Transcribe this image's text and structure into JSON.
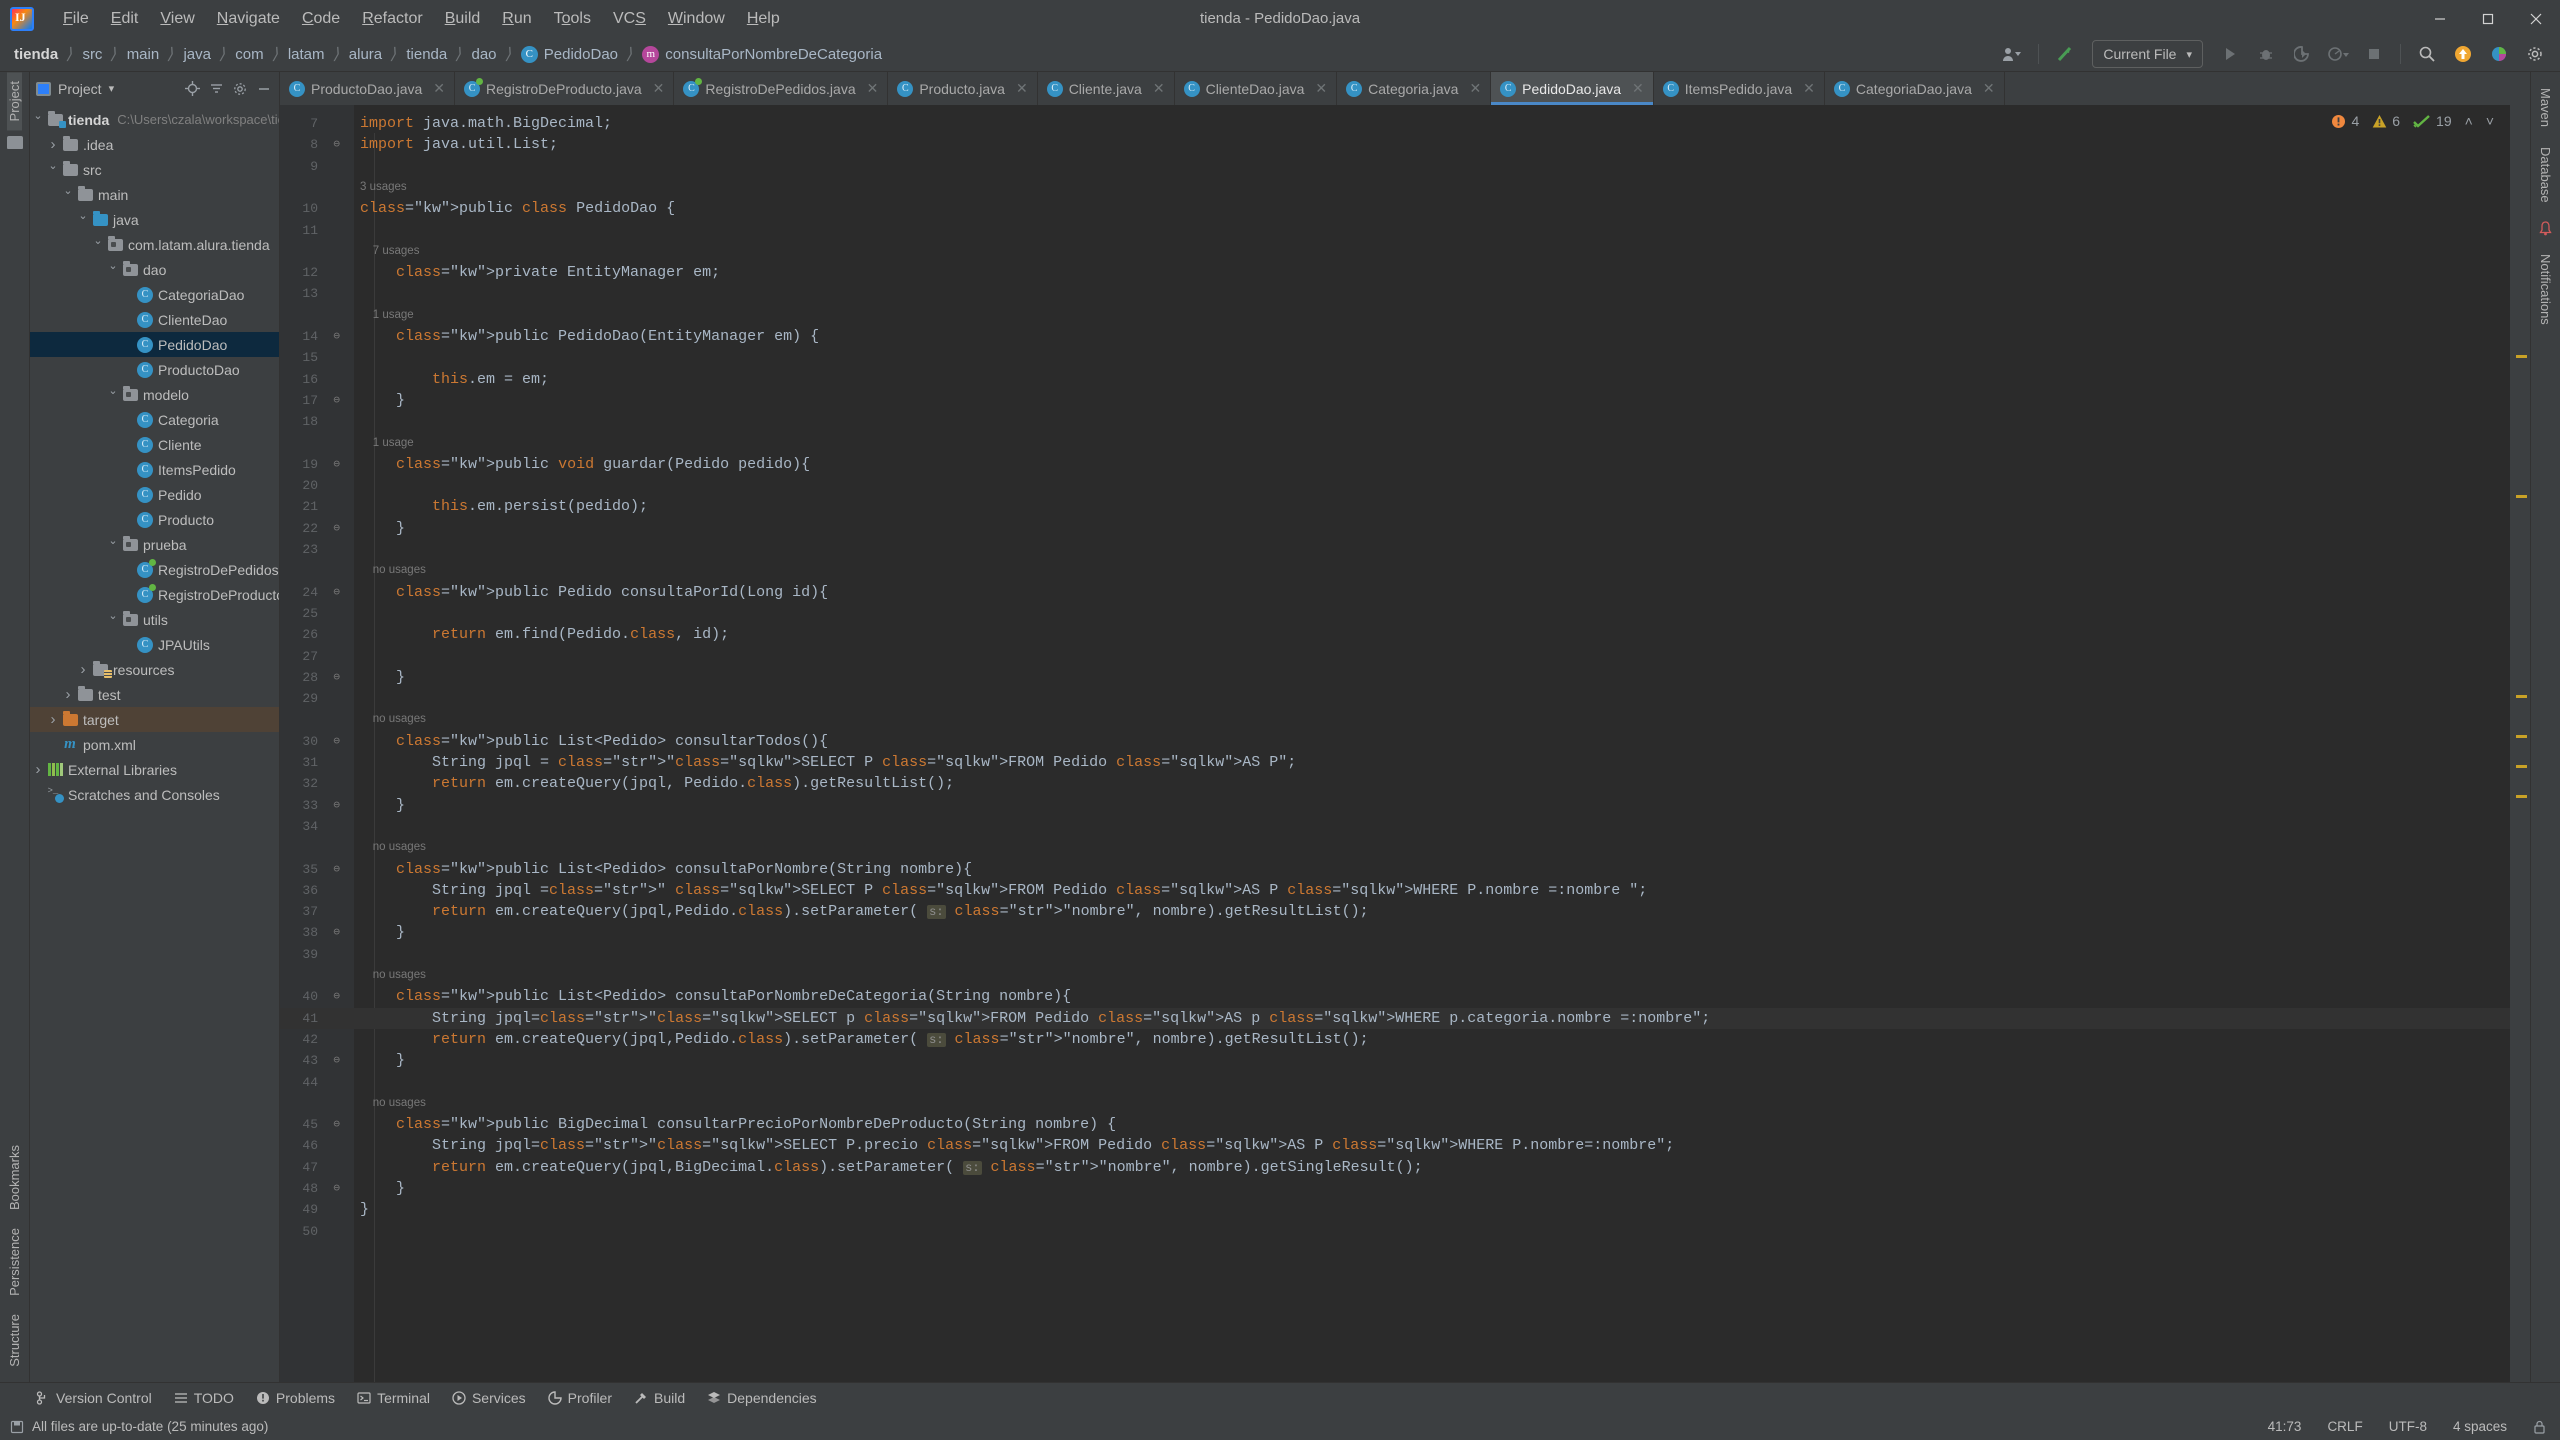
{
  "window": {
    "app_icon": "intellij-idea-logo",
    "title": "tienda - PedidoDao.java",
    "minimize": "–",
    "maximize": "☐",
    "close": "✕"
  },
  "menu": {
    "items": [
      "File",
      "Edit",
      "View",
      "Navigate",
      "Code",
      "Refactor",
      "Build",
      "Run",
      "Tools",
      "VCS",
      "Window",
      "Help"
    ]
  },
  "navbar": {
    "breadcrumbs": [
      {
        "label": "tienda",
        "icon": "",
        "bold": true
      },
      {
        "label": "src",
        "icon": ""
      },
      {
        "label": "main",
        "icon": ""
      },
      {
        "label": "java",
        "icon": ""
      },
      {
        "label": "com",
        "icon": ""
      },
      {
        "label": "latam",
        "icon": ""
      },
      {
        "label": "alura",
        "icon": ""
      },
      {
        "label": "tienda",
        "icon": ""
      },
      {
        "label": "dao",
        "icon": ""
      },
      {
        "label": "PedidoDao",
        "icon": "class-icon",
        "icon_letter": "C"
      },
      {
        "label": "consultaPorNombreDeCategoria",
        "icon": "method-icon",
        "icon_letter": "m"
      }
    ],
    "run_config": "Current File",
    "run_config_caret": "▾",
    "icons": [
      "user-avatar-icon",
      "vcs-update-icon",
      "run-icon",
      "debug-icon",
      "run-coverage-icon",
      "profiler-icon",
      "stop-icon",
      "search-everywhere-icon",
      "updates-available-icon",
      "ide-features-icon",
      "settings-icon"
    ]
  },
  "left_strip": {
    "project_tab": "Project",
    "bottom_tabs": [
      "Bookmarks",
      "Persistence",
      "Structure"
    ]
  },
  "right_strip": {
    "tabs": [
      "Maven",
      "Database",
      "Notifications"
    ]
  },
  "project_panel": {
    "title": "Project",
    "title_caret": "▾",
    "header_icons": [
      "locate-icon",
      "collapse-all-icon",
      "settings-icon",
      "hide-icon"
    ],
    "tree": [
      {
        "depth": 0,
        "chev": "open",
        "icon": "module-folder-icon",
        "label": "tienda",
        "bold": true,
        "path": "C:\\Users\\czala\\workspace\\tienda"
      },
      {
        "depth": 1,
        "chev": "closed",
        "icon": "folder-icon",
        "label": ".idea"
      },
      {
        "depth": 1,
        "chev": "open",
        "icon": "folder-icon",
        "label": "src"
      },
      {
        "depth": 2,
        "chev": "open",
        "icon": "folder-icon",
        "label": "main"
      },
      {
        "depth": 3,
        "chev": "open",
        "icon": "source-folder-icon",
        "label": "java"
      },
      {
        "depth": 4,
        "chev": "open",
        "icon": "package-icon",
        "label": "com.latam.alura.tienda"
      },
      {
        "depth": 5,
        "chev": "open",
        "icon": "package-icon",
        "label": "dao"
      },
      {
        "depth": 6,
        "chev": "blank",
        "icon": "class-icon",
        "label": "CategoriaDao"
      },
      {
        "depth": 6,
        "chev": "blank",
        "icon": "class-icon",
        "label": "ClienteDao"
      },
      {
        "depth": 6,
        "chev": "blank",
        "icon": "class-icon",
        "label": "PedidoDao",
        "selected": true
      },
      {
        "depth": 6,
        "chev": "blank",
        "icon": "class-icon",
        "label": "ProductoDao"
      },
      {
        "depth": 5,
        "chev": "open",
        "icon": "package-icon",
        "label": "modelo"
      },
      {
        "depth": 6,
        "chev": "blank",
        "icon": "class-icon",
        "label": "Categoria"
      },
      {
        "depth": 6,
        "chev": "blank",
        "icon": "class-icon",
        "label": "Cliente"
      },
      {
        "depth": 6,
        "chev": "blank",
        "icon": "class-icon",
        "label": "ItemsPedido"
      },
      {
        "depth": 6,
        "chev": "blank",
        "icon": "class-icon",
        "label": "Pedido"
      },
      {
        "depth": 6,
        "chev": "blank",
        "icon": "class-icon",
        "label": "Producto"
      },
      {
        "depth": 5,
        "chev": "open",
        "icon": "package-icon",
        "label": "prueba"
      },
      {
        "depth": 6,
        "chev": "blank",
        "icon": "runnable-class-icon",
        "label": "RegistroDePedidos"
      },
      {
        "depth": 6,
        "chev": "blank",
        "icon": "runnable-class-icon",
        "label": "RegistroDeProducto"
      },
      {
        "depth": 5,
        "chev": "open",
        "icon": "package-icon",
        "label": "utils"
      },
      {
        "depth": 6,
        "chev": "blank",
        "icon": "class-icon",
        "label": "JPAUtils"
      },
      {
        "depth": 3,
        "chev": "closed",
        "icon": "resources-folder-icon",
        "label": "resources"
      },
      {
        "depth": 2,
        "chev": "closed",
        "icon": "folder-icon",
        "label": "test"
      },
      {
        "depth": 1,
        "chev": "closed",
        "icon": "excluded-folder-icon",
        "label": "target",
        "highlighted": true
      },
      {
        "depth": 1,
        "chev": "blank",
        "icon": "maven-icon",
        "label": "pom.xml"
      },
      {
        "depth": 0,
        "chev": "closed",
        "icon": "library-icon",
        "label": "External Libraries"
      },
      {
        "depth": 0,
        "chev": "blank",
        "icon": "scratches-icon",
        "label": "Scratches and Consoles"
      }
    ]
  },
  "editor_tabs": [
    {
      "label": "ProductoDao.java",
      "icon": "class-icon"
    },
    {
      "label": "RegistroDeProducto.java",
      "icon": "runnable-class-icon"
    },
    {
      "label": "RegistroDePedidos.java",
      "icon": "runnable-class-icon"
    },
    {
      "label": "Producto.java",
      "icon": "class-icon"
    },
    {
      "label": "Cliente.java",
      "icon": "class-icon"
    },
    {
      "label": "ClienteDao.java",
      "icon": "class-icon"
    },
    {
      "label": "Categoria.java",
      "icon": "class-icon"
    },
    {
      "label": "PedidoDao.java",
      "icon": "class-icon",
      "active": true
    },
    {
      "label": "ItemsPedido.java",
      "icon": "class-icon"
    },
    {
      "label": "CategoriaDao.java",
      "icon": "class-icon"
    }
  ],
  "inspections": {
    "error_count": "4",
    "warning_count": "6",
    "ok_count": "19",
    "prev_label": "˄",
    "next_label": "˅"
  },
  "editor": {
    "first_line_number": 7,
    "lines": [
      {
        "n": 7,
        "text": "import java.math.BigDecimal;"
      },
      {
        "n": 8,
        "text": "import java.util.List;",
        "fold": "minus-square"
      },
      {
        "n": 9,
        "text": ""
      },
      {
        "n": null,
        "hint": "3 usages"
      },
      {
        "n": 10,
        "text": "public class PedidoDao {"
      },
      {
        "n": 11,
        "text": ""
      },
      {
        "n": null,
        "hint": "    7 usages"
      },
      {
        "n": 12,
        "text": "    private EntityManager em;"
      },
      {
        "n": 13,
        "text": ""
      },
      {
        "n": null,
        "hint": "    1 usage"
      },
      {
        "n": 14,
        "text": "    public PedidoDao(EntityManager em) {",
        "fold": "fold-start"
      },
      {
        "n": 15,
        "text": ""
      },
      {
        "n": 16,
        "text": "        this.em = em;"
      },
      {
        "n": 17,
        "text": "    }",
        "fold": "fold-end"
      },
      {
        "n": 18,
        "text": ""
      },
      {
        "n": null,
        "hint": "    1 usage"
      },
      {
        "n": 19,
        "text": "    public void guardar(Pedido pedido){",
        "fold": "fold-start"
      },
      {
        "n": 20,
        "text": ""
      },
      {
        "n": 21,
        "text": "        this.em.persist(pedido);"
      },
      {
        "n": 22,
        "text": "    }",
        "fold": "fold-end"
      },
      {
        "n": 23,
        "text": ""
      },
      {
        "n": null,
        "hint": "    no usages"
      },
      {
        "n": 24,
        "text": "    public Pedido consultaPorId(Long id){",
        "fold": "fold-start"
      },
      {
        "n": 25,
        "text": ""
      },
      {
        "n": 26,
        "text": "        return em.find(Pedido.class, id);"
      },
      {
        "n": 27,
        "text": ""
      },
      {
        "n": 28,
        "text": "    }",
        "fold": "fold-end"
      },
      {
        "n": 29,
        "text": ""
      },
      {
        "n": null,
        "hint": "    no usages"
      },
      {
        "n": 30,
        "text": "    public List<Pedido> consultarTodos(){",
        "fold": "fold-start"
      },
      {
        "n": 31,
        "text": "        String jpql = \"SELECT P FROM Pedido AS P\";"
      },
      {
        "n": 32,
        "text": "        return em.createQuery(jpql, Pedido.class).getResultList();"
      },
      {
        "n": 33,
        "text": "    }",
        "fold": "fold-end"
      },
      {
        "n": 34,
        "text": ""
      },
      {
        "n": null,
        "hint": "    no usages"
      },
      {
        "n": 35,
        "text": "    public List<Pedido> consultaPorNombre(String nombre){",
        "fold": "fold-start"
      },
      {
        "n": 36,
        "text": "        String jpql =\" SELECT P FROM Pedido AS P WHERE P.nombre =:nombre \";"
      },
      {
        "n": 37,
        "text": "        return em.createQuery(jpql,Pedido.class).setParameter( s: \"nombre\", nombre).getResultList();"
      },
      {
        "n": 38,
        "text": "    }",
        "fold": "fold-end"
      },
      {
        "n": 39,
        "text": ""
      },
      {
        "n": null,
        "hint": "    no usages"
      },
      {
        "n": 40,
        "text": "    public List<Pedido> consultaPorNombreDeCategoria(String nombre){",
        "fold": "fold-start"
      },
      {
        "n": 41,
        "text": "        String jpql=\"SELECT p FROM Pedido AS p WHERE p.categoria.nombre =:nombre\";",
        "current": true
      },
      {
        "n": 42,
        "text": "        return em.createQuery(jpql,Pedido.class).setParameter( s: \"nombre\", nombre).getResultList();"
      },
      {
        "n": 43,
        "text": "    }",
        "fold": "fold-end"
      },
      {
        "n": 44,
        "text": ""
      },
      {
        "n": null,
        "hint": "    no usages"
      },
      {
        "n": 45,
        "text": "    public BigDecimal consultarPrecioPorNombreDeProducto(String nombre) {",
        "fold": "fold-start"
      },
      {
        "n": 46,
        "text": "        String jpql=\"SELECT P.precio FROM Pedido AS P WHERE P.nombre=:nombre\";"
      },
      {
        "n": 47,
        "text": "        return em.createQuery(jpql,BigDecimal.class).setParameter( s: \"nombre\", nombre).getSingleResult();"
      },
      {
        "n": 48,
        "text": "    }",
        "fold": "fold-end"
      },
      {
        "n": 49,
        "text": "}"
      },
      {
        "n": 50,
        "text": ""
      }
    ]
  },
  "bottom_bar": {
    "buttons": [
      {
        "label": "Version Control",
        "icon": "branch-icon"
      },
      {
        "label": "TODO",
        "icon": "list-icon"
      },
      {
        "label": "Problems",
        "icon": "error-icon"
      },
      {
        "label": "Terminal",
        "icon": "terminal-icon"
      },
      {
        "label": "Services",
        "icon": "services-icon"
      },
      {
        "label": "Profiler",
        "icon": "profiler-icon"
      },
      {
        "label": "Build",
        "icon": "hammer-icon"
      },
      {
        "label": "Dependencies",
        "icon": "dependencies-icon"
      }
    ]
  },
  "status_bar": {
    "message": "All files are up-to-date (25 minutes ago)",
    "message_icon": "save-indicator-icon",
    "caret_position": "41:73",
    "line_separator": "CRLF",
    "encoding": "UTF-8",
    "indent": "4 spaces",
    "lock_icon": "lock-icon"
  },
  "colors": {
    "bg_chrome": "#3c3f41",
    "bg_editor": "#2b2b2b",
    "bg_gutter": "#313335",
    "accent_blue": "#3592c4",
    "tab_active_underline": "#4a88c7",
    "tree_selection": "#0d293e",
    "tree_highlight": "#4f4236",
    "error_orange": "#f0883e",
    "warning_yellow": "#c9a227",
    "ok_green": "#62b543"
  }
}
